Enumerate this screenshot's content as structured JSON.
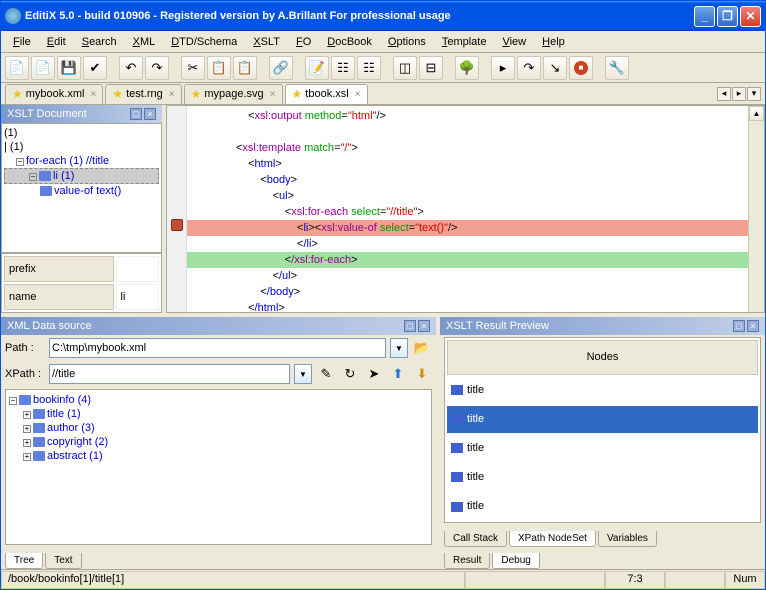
{
  "window": {
    "title": "EditiX 5.0 - build 010906 - Registered version by A.Brillant For professional usage"
  },
  "menus": [
    "File",
    "Edit",
    "Search",
    "XML",
    "DTD/Schema",
    "XSLT",
    "FO",
    "DocBook",
    "Options",
    "Template",
    "View",
    "Help"
  ],
  "tabs": [
    {
      "name": "mybook.xml",
      "active": false
    },
    {
      "name": "test.rng",
      "active": false
    },
    {
      "name": "mypage.svg",
      "active": false
    },
    {
      "name": "tbook.xsl",
      "active": true
    }
  ],
  "leftpanel": {
    "title": "XSLT Document",
    "tree": [
      {
        "label": "(1)",
        "indent": 0
      },
      {
        "label": "| (1)",
        "indent": 0
      },
      {
        "label": "for-each (1) //title",
        "indent": 1,
        "exp": true,
        "color": "#0000cc"
      },
      {
        "label": "li (1)",
        "indent": 2,
        "exp": true,
        "color": "#0000cc",
        "selected": true,
        "elicon": true
      },
      {
        "label": "value-of text()",
        "indent": 3,
        "color": "#0000cc",
        "elicon": true
      }
    ],
    "proprows": [
      [
        "prefix",
        ""
      ],
      [
        "name",
        "li"
      ]
    ]
  },
  "code": [
    {
      "i": 5,
      "html": "&lt;<span class='xsl'>xsl:output</span> <span class='attr'>method</span>=<span class='val'>\"html\"</span>/&gt;"
    },
    {
      "i": 4,
      "html": ""
    },
    {
      "i": 4,
      "html": "&lt;<span class='xsl'>xsl:template</span> <span class='attr'>match</span>=<span class='val'>\"/\"</span>&gt;"
    },
    {
      "i": 5,
      "html": "&lt;<span class='tag'>html</span>&gt;"
    },
    {
      "i": 6,
      "html": "&lt;<span class='tag'>body</span>&gt;"
    },
    {
      "i": 7,
      "html": "&lt;<span class='tag'>ul</span>&gt;"
    },
    {
      "i": 8,
      "html": "&lt;<span class='xsl'>xsl:for-each</span> <span class='attr'>select</span>=<span class='val'>\"//title\"</span>&gt;"
    },
    {
      "i": 9,
      "html": "&lt;<span class='tag'>li</span>&gt;&lt;<span class='xsl'>xsl:value-of</span> <span class='attr'>select</span>=<span class='val'>\"text()\"</span>/&gt;",
      "cls": "hl-red"
    },
    {
      "i": 9,
      "html": "&lt;<span class='tag'>/li</span>&gt;"
    },
    {
      "i": 8,
      "html": "&lt;<span class='xsl'>/xsl:for-each</span>&gt;",
      "cls": "hl-green"
    },
    {
      "i": 7,
      "html": "&lt;<span class='tag'>/ul</span>&gt;"
    },
    {
      "i": 6,
      "html": "&lt;<span class='tag'>/body</span>&gt;"
    },
    {
      "i": 5,
      "html": "&lt;<span class='tag'>/html</span>&gt;"
    }
  ],
  "datasrc": {
    "title": "XML Data source",
    "pathlabel": "Path :",
    "path": "C:\\tmp\\mybook.xml",
    "xpathlabel": "XPath :",
    "xpath": "//title",
    "tree": [
      {
        "label": "bookinfo (4)",
        "indent": 0,
        "exp": true
      },
      {
        "label": "title (1)",
        "indent": 1,
        "plus": true
      },
      {
        "label": "author (3)",
        "indent": 1,
        "plus": true
      },
      {
        "label": "copyright (2)",
        "indent": 1,
        "plus": true
      },
      {
        "label": "abstract (1)",
        "indent": 1,
        "plus": true
      }
    ],
    "tabs": [
      "Tree",
      "Text"
    ]
  },
  "result": {
    "title": "XSLT Result Preview",
    "header": "Nodes",
    "rows": [
      "title",
      "title",
      "title",
      "title",
      "title"
    ],
    "selected": 1,
    "tabs1": [
      "Call Stack",
      "XPath NodeSet",
      "Variables"
    ],
    "tabs2": [
      "Result",
      "Debug"
    ]
  },
  "status": {
    "path": "/book/bookinfo[1]/title[1]",
    "pos": "7:3",
    "numlabel": "Num"
  }
}
